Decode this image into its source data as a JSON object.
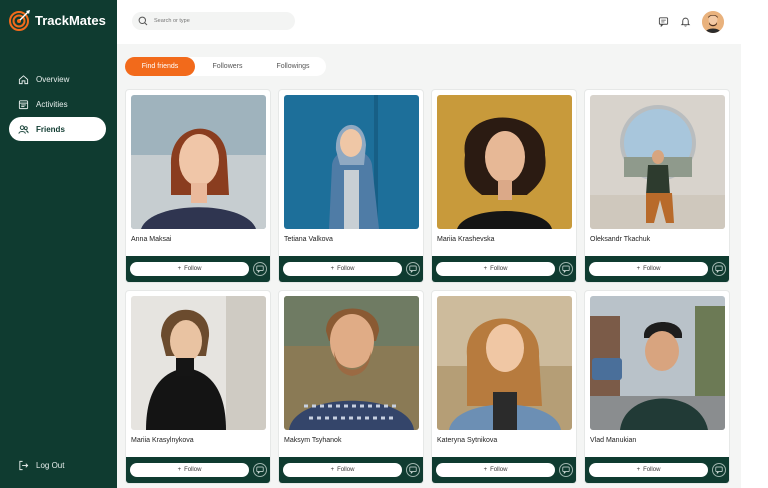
{
  "app": {
    "name": "TrackMates"
  },
  "sidebar": {
    "items": [
      {
        "label": "Overview",
        "icon": "home-icon",
        "active": false
      },
      {
        "label": "Activities",
        "icon": "calendar-icon",
        "active": false
      },
      {
        "label": "Friends",
        "icon": "friends-icon",
        "active": true
      }
    ],
    "logout_label": "Log Out"
  },
  "header": {
    "search_placeholder": "Search or type"
  },
  "tabs": [
    {
      "label": "Find friends",
      "active": true
    },
    {
      "label": "Followers",
      "active": false
    },
    {
      "label": "Followings",
      "active": false
    }
  ],
  "card_actions": {
    "follow_label": "Follow",
    "follow_icon": "+"
  },
  "friends": [
    {
      "name": "Anna Maksai"
    },
    {
      "name": "Tetiana Valkova"
    },
    {
      "name": "Mariia Krashevska"
    },
    {
      "name": "Oleksandr Tkachuk"
    },
    {
      "name": "Mariia Krasylnykova"
    },
    {
      "name": "Maksym Tsyhanok"
    },
    {
      "name": "Kateryna Sytnikova"
    },
    {
      "name": "Vlad Manukian"
    }
  ],
  "colors": {
    "sidebar": "#0f3b30",
    "accent": "#f26a1b",
    "background": "#f4f5f4"
  }
}
